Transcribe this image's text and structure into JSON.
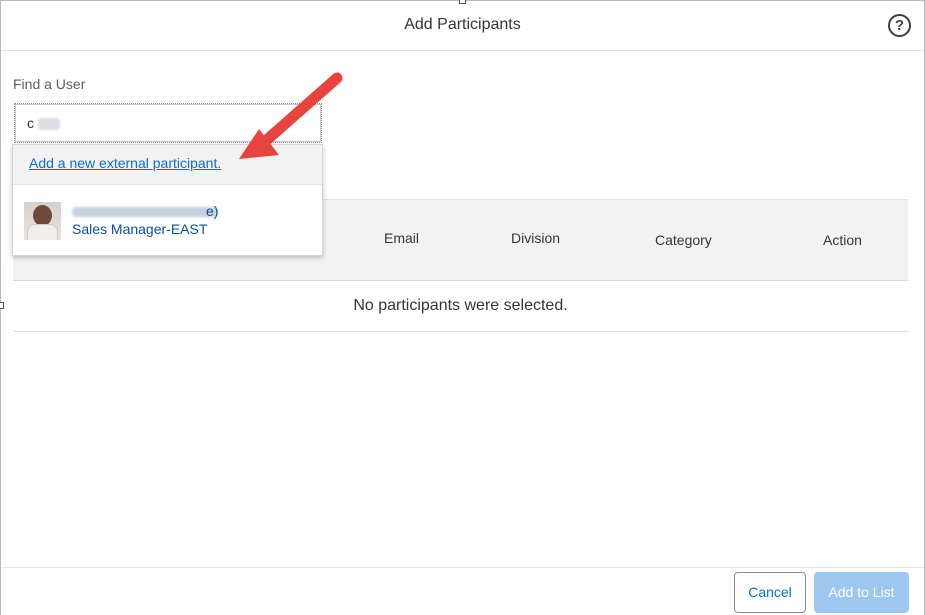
{
  "dialog": {
    "title": "Add Participants",
    "help_icon": "question-circle-icon"
  },
  "search": {
    "label": "Find a User",
    "value": "c"
  },
  "suggestions": {
    "add_external_label": "Add a new external participant.",
    "user": {
      "name_suffix": "e)",
      "title": "Sales Manager-EAST",
      "avatar_icon": "user-photo"
    }
  },
  "table": {
    "columns": [
      "Email",
      "Division",
      "Category",
      "Action"
    ],
    "empty_message": "No participants were selected."
  },
  "footer": {
    "cancel_label": "Cancel",
    "add_label": "Add to List"
  },
  "colors": {
    "link": "#0a6ed1",
    "primary_disabled": "#9ec7ef",
    "annotation_arrow": "#e8433f"
  }
}
